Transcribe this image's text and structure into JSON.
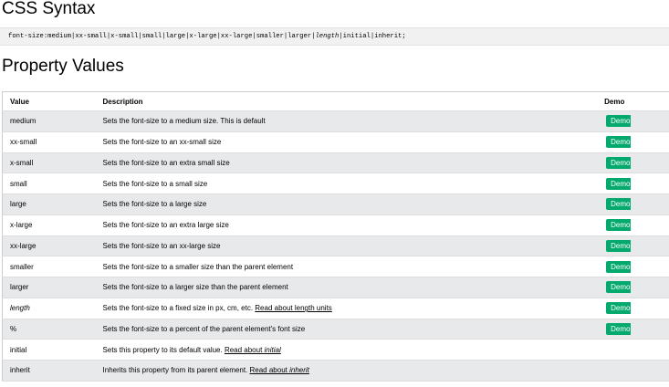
{
  "syntax_section": {
    "heading": "CSS Syntax",
    "code_prefix": "font-size:medium|xx-small|x-small|small|large|x-large|xx-large|smaller|larger|",
    "code_italic": "length",
    "code_suffix": "|initial|inherit;"
  },
  "values_section": {
    "heading": "Property Values",
    "columns": [
      "Value",
      "Description",
      "Demo"
    ],
    "demo_label": "Demo",
    "rows": [
      {
        "value": "medium",
        "desc": "Sets the font-size to a medium size. This is default"
      },
      {
        "value": "xx-small",
        "desc": "Sets the font-size to an xx-small size"
      },
      {
        "value": "x-small",
        "desc": "Sets the font-size to an extra small size"
      },
      {
        "value": "small",
        "desc": "Sets the font-size to a small size"
      },
      {
        "value": "large",
        "desc": "Sets the font-size to a large size"
      },
      {
        "value": "x-large",
        "desc": "Sets the font-size to an extra large size"
      },
      {
        "value": "xx-large",
        "desc": "Sets the font-size to an xx-large size"
      },
      {
        "value": "smaller",
        "desc": "Sets the font-size to a smaller size than the parent element"
      },
      {
        "value": "larger",
        "desc": "Sets the font-size to a larger size than the parent element"
      },
      {
        "value": "length",
        "desc": "Sets the font-size to a fixed size in px, cm, etc. ",
        "link": "Read about length units"
      },
      {
        "value": "%",
        "desc": "Sets the font-size to a percent of  the parent element's font size"
      },
      {
        "value": "initial",
        "desc": "Sets this property to its default value. ",
        "link_prefix": "Read about ",
        "link_italic": "initial"
      },
      {
        "value": "inherit",
        "desc": "Inherits this property from its parent element. ",
        "link_prefix": "Read about ",
        "link_italic": "inherit"
      }
    ]
  },
  "colors": {
    "demo_button": "#04aa6d",
    "stripe": "#e7e9eb",
    "code_bg": "#f1f1f1"
  }
}
